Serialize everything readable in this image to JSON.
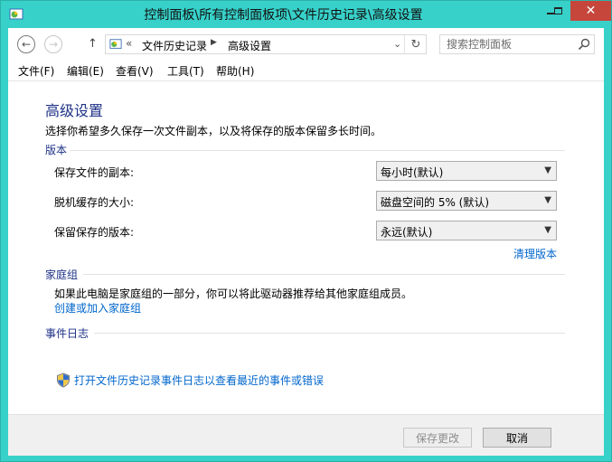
{
  "window": {
    "title": "控制面板\\所有控制面板项\\文件历史记录\\高级设置"
  },
  "address": {
    "chevron": "«",
    "crumbs": [
      "文件历史记录",
      "高级设置"
    ]
  },
  "search": {
    "placeholder": "搜索控制面板"
  },
  "menu": [
    "文件(F)",
    "编辑(E)",
    "查看(V)",
    "工具(T)",
    "帮助(H)"
  ],
  "page": {
    "title": "高级设置",
    "intro": "选择你希望多久保存一次文件副本，以及将保存的版本保留多长时间。",
    "versions": {
      "heading": "版本",
      "rows": [
        {
          "label": "保存文件的副本:",
          "value": "每小时(默认)"
        },
        {
          "label": "脱机缓存的大小:",
          "value": "磁盘空间的 5% (默认)"
        },
        {
          "label": "保留保存的版本:",
          "value": "永远(默认)"
        }
      ],
      "cleanup_link": "清理版本"
    },
    "homegroup": {
      "heading": "家庭组",
      "text": "如果此电脑是家庭组的一部分，你可以将此驱动器推荐给其他家庭组成员。",
      "link": "创建或加入家庭组"
    },
    "eventlog": {
      "heading": "事件日志",
      "link": "打开文件历史记录事件日志以查看最近的事件或错误"
    }
  },
  "footer": {
    "save_label": "保存更改",
    "cancel_label": "取消"
  },
  "colors": {
    "titlebar": "#37d1c9",
    "heading": "#1e3287",
    "link": "#0066cc",
    "close": "#c7463c"
  }
}
